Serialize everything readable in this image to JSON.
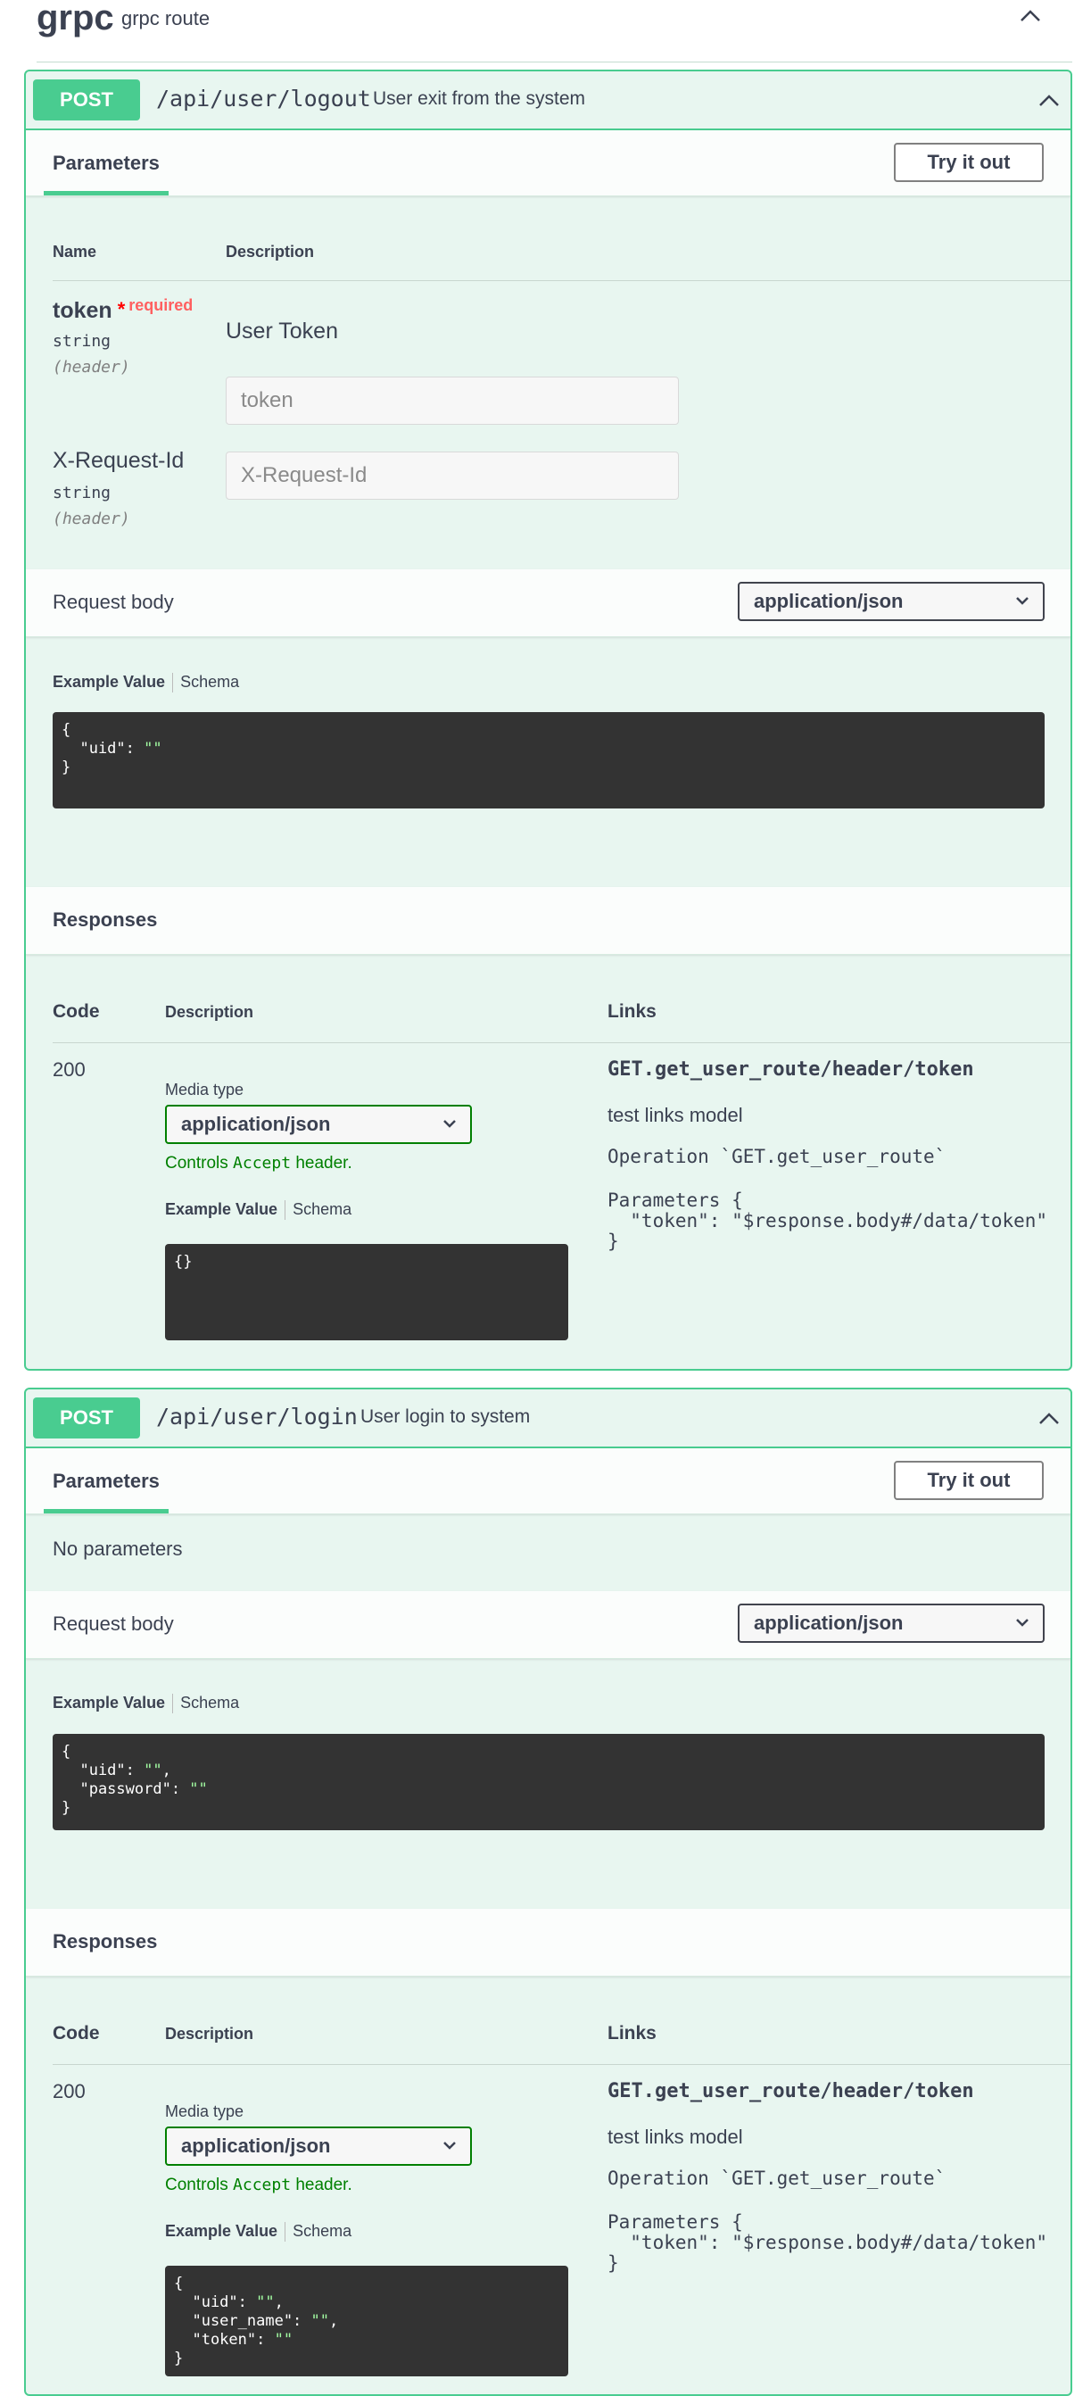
{
  "tag": {
    "name": "grpc",
    "description": "grpc route"
  },
  "operations": [
    {
      "method": "POST",
      "path": "/api/user/logout",
      "summary": "User exit from the system",
      "parameters_tab": "Parameters",
      "try_button": "Try it out",
      "param_headers": {
        "name": "Name",
        "description": "Description"
      },
      "params": [
        {
          "name": "token",
          "required_star": "*",
          "required_text": "required",
          "type": "string",
          "in": "(header)",
          "description": "User Token",
          "placeholder": "token"
        },
        {
          "name": "X-Request-Id",
          "type": "string",
          "in": "(header)",
          "placeholder": "X-Request-Id"
        }
      ],
      "request_body": {
        "label": "Request body",
        "content_type": "application/json"
      },
      "example_tabs": {
        "example": "Example Value",
        "schema": "Schema"
      },
      "request_example": [
        "{",
        "  \"uid\": \"\"",
        "}"
      ],
      "responses": {
        "title": "Responses",
        "headers": {
          "code": "Code",
          "description": "Description",
          "links": "Links"
        },
        "code": "200",
        "media_type_label": "Media type",
        "media_type": "application/json",
        "controls_prefix": "Controls ",
        "controls_mono": "Accept",
        "controls_suffix": " header.",
        "example": [
          "{}"
        ],
        "link_operation": "GET.get_user_route/header/token",
        "link_description": "test links model",
        "link_operation_line": "Operation `GET.get_user_route`",
        "link_parameters": [
          "Parameters {",
          "  \"token\": \"$response.body#/data/token\"",
          "}"
        ]
      }
    },
    {
      "method": "POST",
      "path": "/api/user/login",
      "summary": "User login to system",
      "parameters_tab": "Parameters",
      "try_button": "Try it out",
      "no_params": "No parameters",
      "request_body": {
        "label": "Request body",
        "content_type": "application/json"
      },
      "example_tabs": {
        "example": "Example Value",
        "schema": "Schema"
      },
      "request_example": [
        "{",
        "  \"uid\": \"\",",
        "  \"password\": \"\"",
        "}"
      ],
      "responses": {
        "title": "Responses",
        "headers": {
          "code": "Code",
          "description": "Description",
          "links": "Links"
        },
        "code": "200",
        "media_type_label": "Media type",
        "media_type": "application/json",
        "controls_prefix": "Controls ",
        "controls_mono": "Accept",
        "controls_suffix": " header.",
        "example": [
          "{",
          "  \"uid\": \"\",",
          "  \"user_name\": \"\",",
          "  \"token\": \"\"",
          "}"
        ],
        "link_operation": "GET.get_user_route/header/token",
        "link_description": "test links model",
        "link_operation_line": "Operation `GET.get_user_route`",
        "link_parameters": [
          "Parameters {",
          "  \"token\": \"$response.body#/data/token\"",
          "}"
        ]
      }
    }
  ],
  "colors": {
    "post": "#49cc90",
    "post_bg": "#e8f6f0",
    "code_bg": "#333333",
    "string": "#a2fca2",
    "required": "#ff0000",
    "controls": "#008000"
  },
  "icons": {
    "collapse": "chevron-up-icon",
    "dropdown": "chevron-down-icon"
  }
}
